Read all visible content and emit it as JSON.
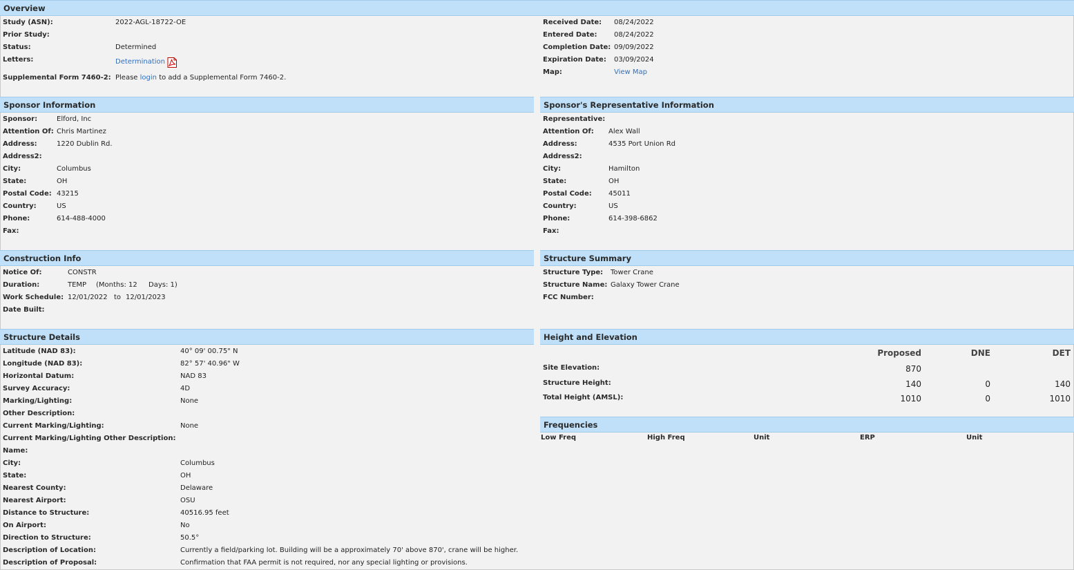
{
  "overview": {
    "title": "Overview",
    "study_label": "Study (ASN):",
    "study_value": "2022-AGL-18722-OE",
    "prior_label": "Prior Study:",
    "prior_value": "",
    "status_label": "Status:",
    "status_value": "Determined",
    "letters_label": "Letters:",
    "letters_link": "Determination",
    "supplemental_label": "Supplemental Form 7460-2:",
    "supplemental_prefix": "Please",
    "supplemental_link": "login",
    "supplemental_suffix": "to add a Supplemental Form 7460-2.",
    "received_label": "Received Date:",
    "received_value": "08/24/2022",
    "entered_label": "Entered Date:",
    "entered_value": "08/24/2022",
    "completion_label": "Completion Date:",
    "completion_value": "09/09/2022",
    "expiration_label": "Expiration Date:",
    "expiration_value": "03/09/2024",
    "map_label": "Map:",
    "map_link": "View Map"
  },
  "sponsor": {
    "title": "Sponsor Information",
    "rows": [
      {
        "label": "Sponsor:",
        "value": "Elford, Inc"
      },
      {
        "label": "Attention Of:",
        "value": "Chris Martinez"
      },
      {
        "label": "Address:",
        "value": "1220 Dublin Rd."
      },
      {
        "label": "Address2:",
        "value": ""
      },
      {
        "label": "City:",
        "value": "Columbus"
      },
      {
        "label": "State:",
        "value": "OH"
      },
      {
        "label": "Postal Code:",
        "value": "43215"
      },
      {
        "label": "Country:",
        "value": "US"
      },
      {
        "label": "Phone:",
        "value": "614-488-4000"
      },
      {
        "label": "Fax:",
        "value": ""
      }
    ]
  },
  "representative": {
    "title": "Sponsor's Representative Information",
    "rows": [
      {
        "label": "Representative:",
        "value": ""
      },
      {
        "label": "Attention Of:",
        "value": "Alex Wall"
      },
      {
        "label": "Address:",
        "value": "4535 Port Union Rd"
      },
      {
        "label": "Address2:",
        "value": ""
      },
      {
        "label": "City:",
        "value": "Hamilton"
      },
      {
        "label": "State:",
        "value": "OH"
      },
      {
        "label": "Postal Code:",
        "value": "45011"
      },
      {
        "label": "Country:",
        "value": "US"
      },
      {
        "label": "Phone:",
        "value": "614-398-6862"
      },
      {
        "label": "Fax:",
        "value": ""
      }
    ]
  },
  "construction": {
    "title": "Construction Info",
    "notice_label": "Notice Of:",
    "notice_value": "CONSTR",
    "duration_label": "Duration:",
    "duration_value": "TEMP",
    "months_text": "(Months: 12",
    "days_text": "Days: 1)",
    "schedule_label": "Work Schedule:",
    "schedule_start": "12/01/2022",
    "schedule_to": "to",
    "schedule_end": "12/01/2023",
    "built_label": "Date Built:",
    "built_value": ""
  },
  "structure_summary": {
    "title": "Structure Summary",
    "rows": [
      {
        "label": "Structure Type:",
        "value": "Tower Crane"
      },
      {
        "label": "Structure Name:",
        "value": "Galaxy Tower Crane"
      },
      {
        "label": "FCC Number:",
        "value": ""
      }
    ]
  },
  "structure_details": {
    "title": "Structure Details",
    "rows": [
      {
        "label": "Latitude (NAD 83):",
        "value": "40° 09' 00.75\" N"
      },
      {
        "label": "Longitude (NAD 83):",
        "value": "82° 57' 40.96\" W"
      },
      {
        "label": "Horizontal Datum:",
        "value": "NAD 83"
      },
      {
        "label": "Survey Accuracy:",
        "value": "4D"
      },
      {
        "label": "Marking/Lighting:",
        "value": "None"
      },
      {
        "label": "Other Description:",
        "value": ""
      },
      {
        "label": "Current Marking/Lighting:",
        "value": "None"
      },
      {
        "label": "Current Marking/Lighting Other Description:",
        "value": ""
      },
      {
        "label": "Name:",
        "value": ""
      },
      {
        "label": "City:",
        "value": "Columbus"
      },
      {
        "label": "State:",
        "value": "OH"
      },
      {
        "label": "Nearest County:",
        "value": "Delaware"
      },
      {
        "label": "Nearest Airport:",
        "value": "OSU"
      },
      {
        "label": "Distance to Structure:",
        "value": "40516.95 feet"
      },
      {
        "label": "On Airport:",
        "value": "No"
      },
      {
        "label": "Direction to Structure:",
        "value": "50.5°"
      },
      {
        "label": "Description of Location:",
        "value": "Currently a field/parking lot. Building will be a approximately 70' above 870', crane will be higher."
      },
      {
        "label": "Description of Proposal:",
        "value": "Confirmation that FAA permit is not required, nor any special lighting or provisions."
      }
    ]
  },
  "height": {
    "title": "Height and Elevation",
    "col_proposed": "Proposed",
    "col_dne": "DNE",
    "col_det": "DET",
    "rows": [
      {
        "label": "Site Elevation:",
        "proposed": "870",
        "dne": "",
        "det": ""
      },
      {
        "label": "Structure Height:",
        "proposed": "140",
        "dne": "0",
        "det": "140"
      },
      {
        "label": "Total Height (AMSL):",
        "proposed": "1010",
        "dne": "0",
        "det": "1010"
      }
    ]
  },
  "frequencies": {
    "title": "Frequencies",
    "columns": [
      "Low Freq",
      "High Freq",
      "Unit",
      "ERP",
      "Unit"
    ]
  }
}
